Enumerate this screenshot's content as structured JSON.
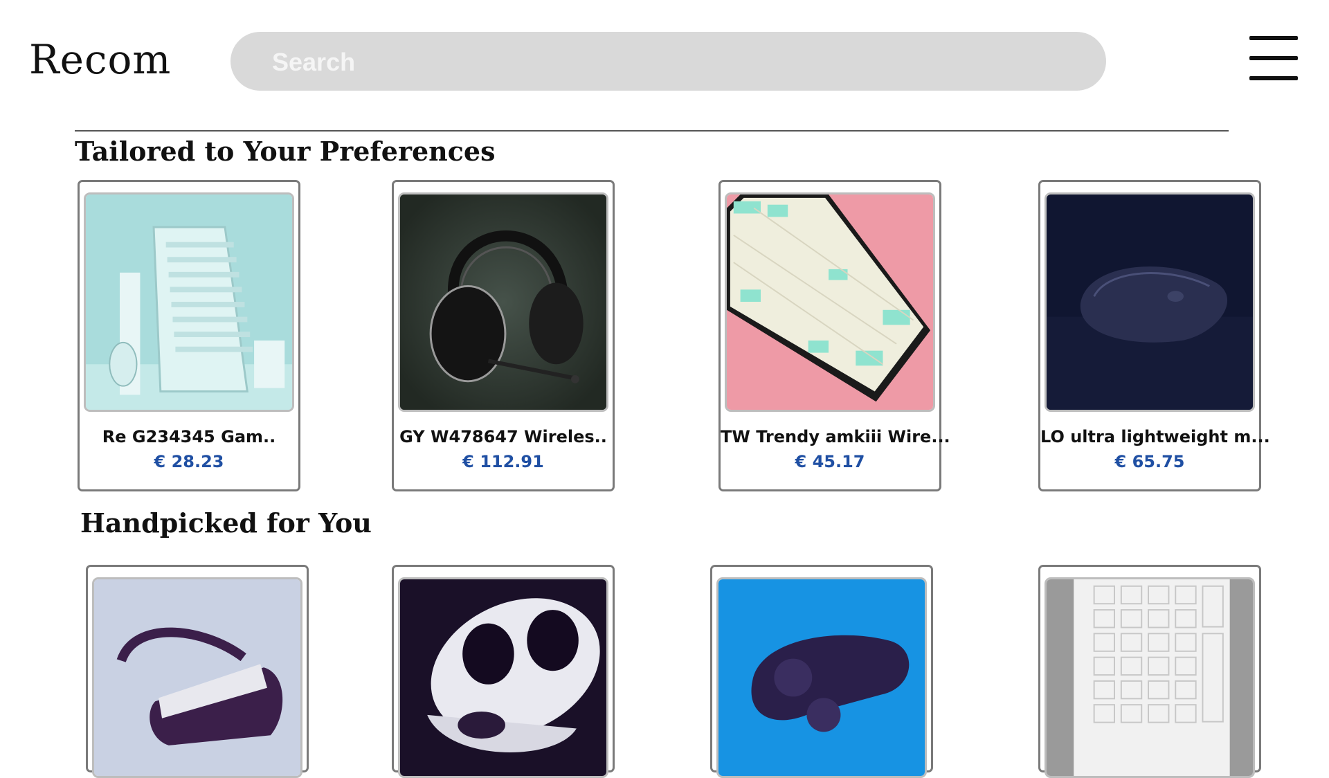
{
  "header": {
    "logo": "Recom",
    "search_placeholder": "Search",
    "menu_icon": "hamburger-menu-icon"
  },
  "sections": [
    {
      "title": "Tailored to Your Preferences",
      "products": [
        {
          "name": "Re G234345 Gam..",
          "price": "€ 28.23",
          "image": "mint gaming keyboard and mouse"
        },
        {
          "name": "GY W478647 Wireles..",
          "price": "€ 112.91",
          "image": "black over-ear headset"
        },
        {
          "name": "TW Trendy amkiii Wire...",
          "price": "€ 45.17",
          "image": "mint and cream mechanical keyboard"
        },
        {
          "name": "LO ultra lightweight m...",
          "price": "€ 65.75",
          "image": "dark wireless mouse"
        }
      ]
    },
    {
      "title": "Handpicked for You",
      "products": [
        {
          "image": "VR headset"
        },
        {
          "image": "wireless earbuds case"
        },
        {
          "image": "game controller"
        },
        {
          "image": "white keyboard"
        }
      ]
    }
  ],
  "colors": {
    "price": "#1f4fa3",
    "search_bg": "#d9d9d9",
    "card_border": "#7a7a7a"
  }
}
